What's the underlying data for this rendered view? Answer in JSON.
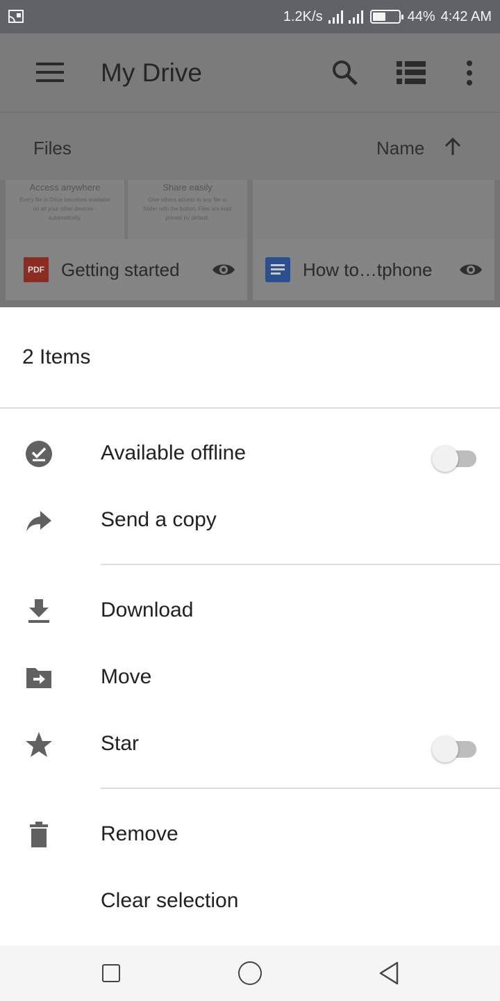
{
  "status_bar": {
    "net_speed": "1.2K/s",
    "battery": "44%",
    "time": "4:42 AM",
    "icons": [
      "cast-icon",
      "signal-icon",
      "signal-h-plus-icon",
      "battery-icon"
    ]
  },
  "app_bar": {
    "title": "My Drive",
    "icons": [
      "menu-icon",
      "search-icon",
      "list-view-icon",
      "more-vert-icon"
    ]
  },
  "sort_bar": {
    "section_label": "Files",
    "sort_label": "Name",
    "sort_direction_icon": "arrow-up-icon"
  },
  "files": [
    {
      "name": "Getting started",
      "type_icon": "pdf-icon",
      "thumb_panels": [
        {
          "title": "Access anywhere",
          "desc": "Every file in Drive becomes available on all your other devices - automatically."
        },
        {
          "title": "Share easily",
          "desc": "Give others access to any file or folder with the button. Files are kept private by default."
        }
      ]
    },
    {
      "name": "How to…tphone",
      "type_icon": "docs-icon"
    }
  ],
  "sheet": {
    "title": "2 Items",
    "items": [
      {
        "label": "Available offline",
        "icon": "offline-check-icon",
        "toggle": false
      },
      {
        "label": "Send a copy",
        "icon": "share-arrow-icon"
      },
      {
        "label": "Download",
        "icon": "download-icon"
      },
      {
        "label": "Move",
        "icon": "move-folder-icon"
      },
      {
        "label": "Star",
        "icon": "star-icon",
        "toggle": false
      },
      {
        "label": "Remove",
        "icon": "trash-icon"
      },
      {
        "label": "Clear selection"
      }
    ]
  },
  "nav_bar": {
    "icons": [
      "recents-icon",
      "home-icon",
      "back-icon"
    ]
  },
  "colors": {
    "status_bar": "#5f6368",
    "scrim_surface": "#7b7b7b",
    "sheet_bg": "#ffffff",
    "icon_gray": "#616161",
    "toggle_off_track": "#bdbdbd",
    "pdf_red": "#8a2c22",
    "docs_blue": "#2c4f8f"
  }
}
